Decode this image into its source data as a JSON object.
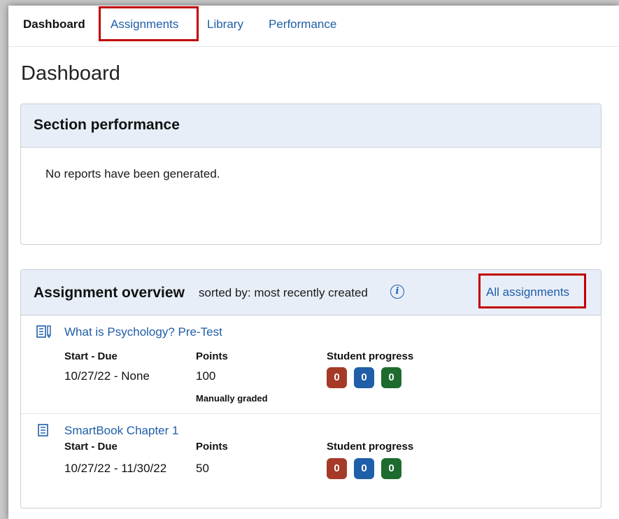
{
  "nav": {
    "items": [
      {
        "label": "Dashboard"
      },
      {
        "label": "Assignments"
      },
      {
        "label": "Library"
      },
      {
        "label": "Performance"
      }
    ]
  },
  "page": {
    "title": "Dashboard"
  },
  "section_performance": {
    "title": "Section performance",
    "empty_message": "No reports have been generated."
  },
  "overview": {
    "title": "Assignment overview",
    "sorted_text": "sorted by: most recently created",
    "info_glyph": "i",
    "all_link": "All assignments",
    "columns": {
      "start_due": "Start - Due",
      "points": "Points",
      "progress": "Student progress"
    },
    "assignments": [
      {
        "name": "What is Psychology? Pre-Test",
        "icon": "test-icon",
        "start_due": "10/27/22 - None",
        "points": "100",
        "note": "Manually graded",
        "progress": [
          "0",
          "0",
          "0"
        ]
      },
      {
        "name": "SmartBook Chapter 1",
        "icon": "document-icon",
        "start_due": "10/27/22 - 11/30/22",
        "points": "50",
        "note": "",
        "progress": [
          "0",
          "0",
          "0"
        ]
      }
    ]
  },
  "colors": {
    "link": "#1f5ea8",
    "header_bg": "#e8eef8",
    "highlight": "#c00000",
    "progress_red": "#a63a28",
    "progress_blue": "#1f5ea8",
    "progress_green": "#1e6b2f"
  }
}
